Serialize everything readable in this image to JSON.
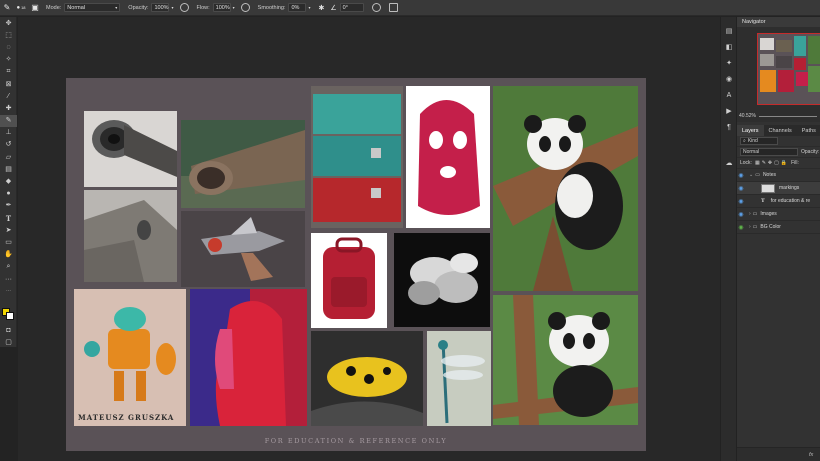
{
  "options_bar": {
    "mode_label": "Mode:",
    "mode_value": "Normal",
    "opacity_label": "Opacity:",
    "opacity_value": "100%",
    "flow_label": "Flow:",
    "flow_value": "100%",
    "smoothing_label": "Smoothing:",
    "smoothing_value": "0%",
    "angle_value": "0°",
    "brush_size": "18"
  },
  "toolbar": {
    "icons": [
      "move-icon",
      "marquee-icon",
      "lasso-icon",
      "magic-wand-icon",
      "crop-icon",
      "frame-icon",
      "eyedropper-icon",
      "healing-brush-icon",
      "brush-icon",
      "clone-stamp-icon",
      "history-brush-icon",
      "eraser-icon",
      "gradient-icon",
      "blur-icon",
      "dodge-icon",
      "pen-icon",
      "type-icon",
      "path-select-icon",
      "rectangle-icon",
      "hand-icon",
      "zoom-icon",
      "more-tools-icon"
    ],
    "active_index": 8,
    "foreground_color": "#f2d600",
    "background_color": "#ffffff"
  },
  "document": {
    "caption": "FOR EDUCATION & REFERENCE ONLY",
    "signature": "MATEUSZ GRUSZKA",
    "background_color": "#5a5257"
  },
  "navigator": {
    "title": "Navigator",
    "zoom": "40.52%"
  },
  "layers_panel": {
    "tabs": [
      "Layers",
      "Channels",
      "Paths"
    ],
    "active_tab": "Layers",
    "filter_label": "Kind",
    "blend_mode": "Normal",
    "opacity_label": "Opacity:",
    "lock_label": "Lock:",
    "fill_label": "Fill:",
    "layers": [
      {
        "name": "Notes",
        "type": "group",
        "indent": 0,
        "visible": true,
        "color": "#5ca0e8",
        "selected": false
      },
      {
        "name": "markings",
        "type": "pixel",
        "indent": 1,
        "visible": true,
        "color": "#5ca0e8",
        "selected": true
      },
      {
        "name": "for education & re",
        "type": "text",
        "indent": 1,
        "visible": true,
        "color": "#5ca0e8",
        "selected": false
      },
      {
        "name": "Images",
        "type": "group",
        "indent": 0,
        "visible": true,
        "color": "#5ca0e8",
        "selected": false
      },
      {
        "name": "BG Color",
        "type": "group",
        "indent": 0,
        "visible": true,
        "color": "#5fb44a",
        "selected": false
      }
    ],
    "footer": "fx"
  }
}
